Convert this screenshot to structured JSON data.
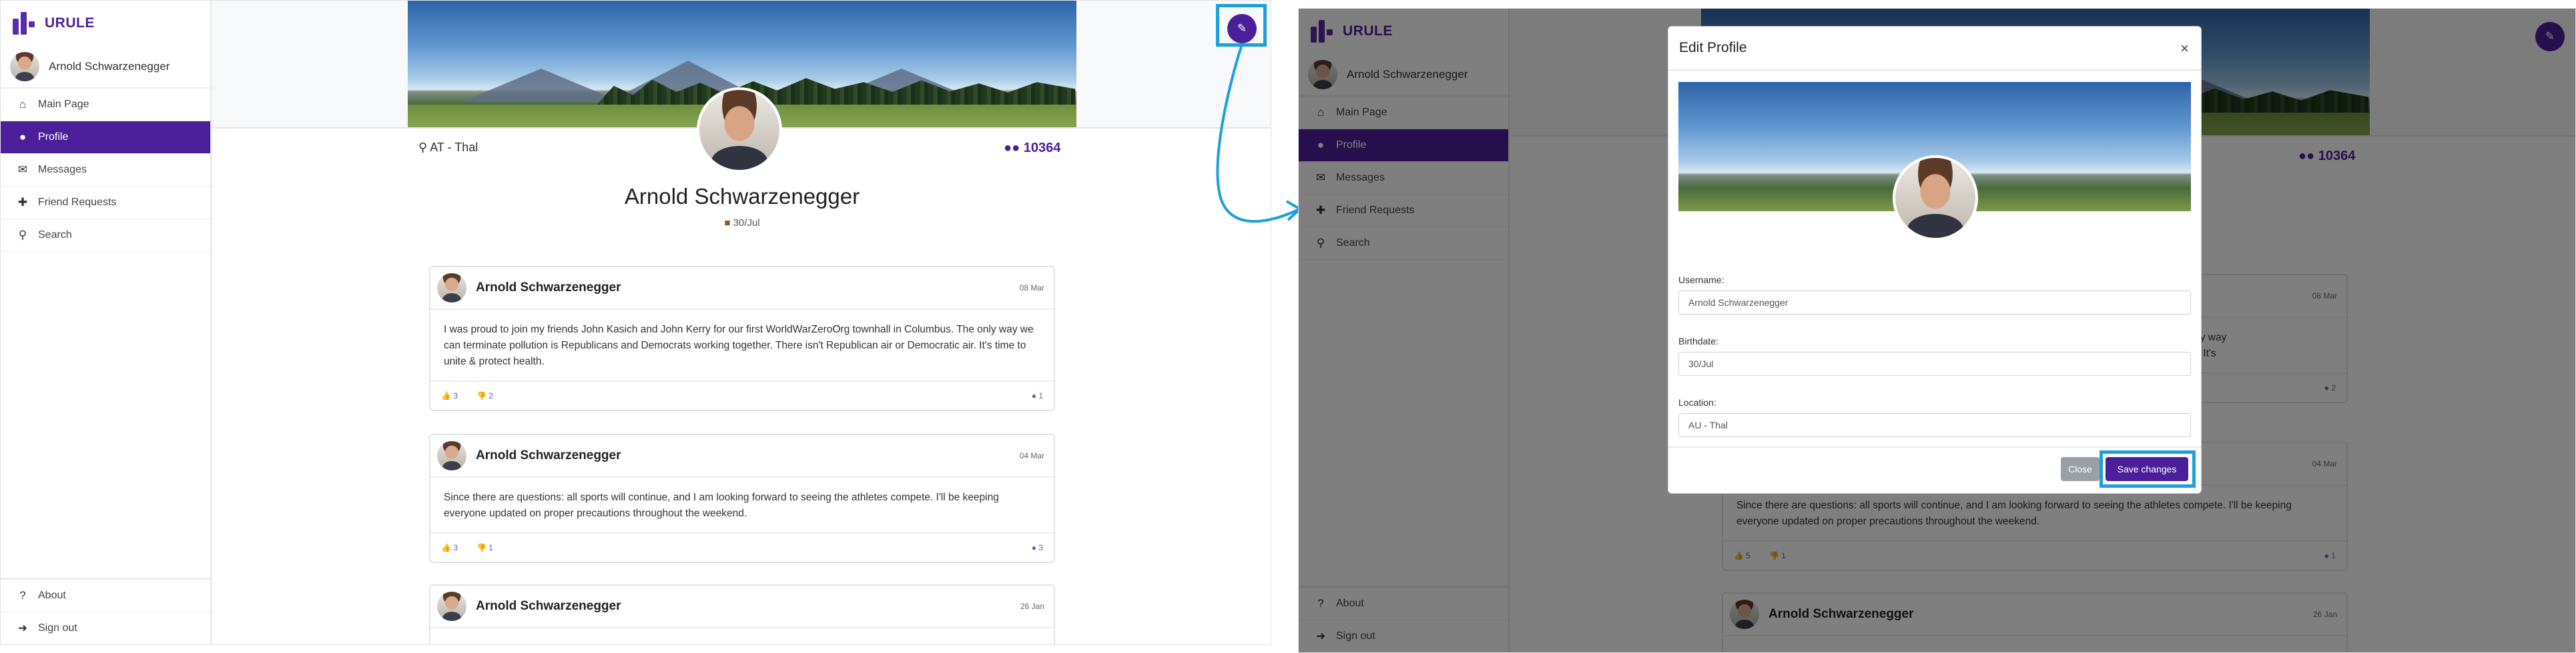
{
  "brand": {
    "name": "URULE"
  },
  "user": {
    "name": "Arnold Schwarzenegger"
  },
  "nav": {
    "items": [
      {
        "label": "Main Page",
        "icon": "home-icon"
      },
      {
        "label": "Profile",
        "icon": "user-icon",
        "active": true
      },
      {
        "label": "Messages",
        "icon": "envelope-icon"
      },
      {
        "label": "Friend Requests",
        "icon": "user-plus-icon"
      },
      {
        "label": "Search",
        "icon": "search-icon"
      }
    ],
    "bottom": [
      {
        "label": "About",
        "icon": "question-circle-icon"
      },
      {
        "label": "Sign out",
        "icon": "sign-out-icon"
      }
    ]
  },
  "profile": {
    "name": "Arnold Schwarzenegger",
    "location": "AT - Thal",
    "followers": "10364",
    "birthday": "30/Jul"
  },
  "posts": [
    {
      "author": "Arnold Schwarzenegger",
      "date": "08 Mar",
      "text": "I was proud to join my friends John Kasich and John Kerry for our first WorldWarZeroOrg townhall in Columbus. The only way we can terminate pollution is Republicans and Democrats working together. There isn't Republican air or Democratic air. It's time to unite & protect health.",
      "likes": "3",
      "dislikes": "2",
      "comments": "1"
    },
    {
      "author": "Arnold Schwarzenegger",
      "date": "04 Mar",
      "text": "Since there are questions: all sports will continue, and I am looking forward to seeing the athletes compete. I'll be keeping everyone updated on proper precautions throughout the weekend.",
      "likes": "3",
      "dislikes": "1",
      "comments": "3"
    },
    {
      "author": "Arnold Schwarzenegger",
      "date": "26 Jan",
      "text": "",
      "likes": "",
      "dislikes": "",
      "comments": ""
    }
  ],
  "right_posts": [
    {
      "date": "08 Mar",
      "text_fragment": "n Columbus. The only way",
      "text_fragment2": "air or Democratic air. It's",
      "likes": "",
      "dislikes": "",
      "comments": "2"
    },
    {
      "date": "04 Mar",
      "text": "Since there are questions: all sports will continue, and I am looking forward to seeing the athletes compete. I'll be keeping everyone updated on proper precautions throughout the weekend.",
      "likes": "5",
      "dislikes": "1",
      "comments": "1"
    },
    {
      "author": "Arnold Schwarzenegger",
      "date": "26 Jan"
    }
  ],
  "modal": {
    "title": "Edit Profile",
    "username_label": "Username:",
    "username_value": "Arnold Schwarzenegger",
    "birthdate_label": "Birthdate:",
    "birthdate_value": "30/Jul",
    "location_label": "Location:",
    "location_value": "AU - Thal",
    "close_label": "Close",
    "save_label": "Save changes"
  },
  "colors": {
    "accent": "#4b1f99",
    "highlight": "#1aa0dc"
  }
}
